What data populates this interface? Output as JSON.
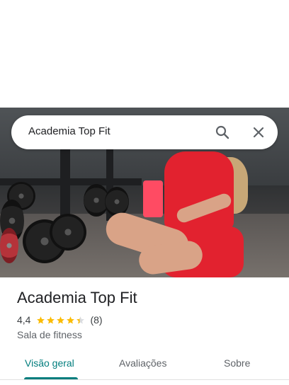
{
  "search": {
    "query": "Academia Top Fit",
    "search_icon": "search-icon",
    "close_icon": "close-icon"
  },
  "place": {
    "name": "Academia Top Fit",
    "rating": "4,4",
    "rating_value": 4.4,
    "review_count": "(8)",
    "category": "Sala de fitness"
  },
  "tabs": [
    {
      "label": "Visão geral",
      "active": true
    },
    {
      "label": "Avaliações",
      "active": false
    },
    {
      "label": "Sobre",
      "active": false
    }
  ],
  "colors": {
    "accent": "#017d7d",
    "star": "#fbbc04",
    "star_empty": "#dadce0"
  }
}
